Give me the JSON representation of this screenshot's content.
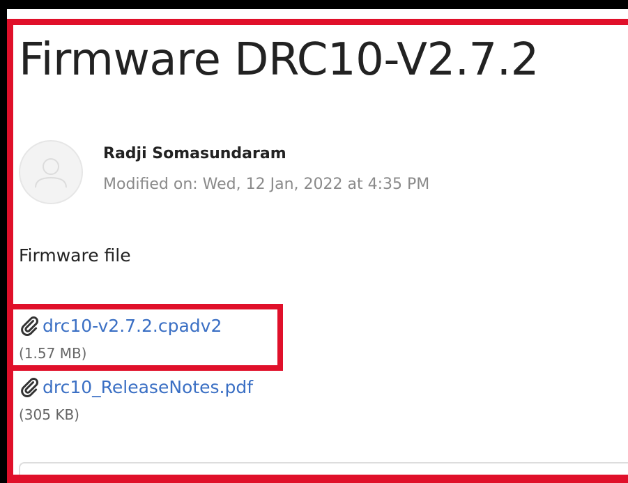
{
  "article": {
    "title": "Firmware DRC10-V2.7.2",
    "author": {
      "name": "Radji Somasundaram",
      "modified": "Modified on: Wed, 12 Jan, 2022 at 4:35 PM",
      "avatar_icon": "user-placeholder-icon"
    },
    "body_text": "Firmware file",
    "attachments": [
      {
        "filename": "drc10-v2.7.2.cpadv2",
        "size": "(1.57 MB)",
        "icon": "paperclip-icon"
      },
      {
        "filename": "drc10_ReleaseNotes.pdf",
        "size": "(305 KB)",
        "icon": "paperclip-icon"
      }
    ]
  },
  "colors": {
    "highlight": "#e0102a",
    "link": "#3a6fc4",
    "title_text": "#222222",
    "muted_text": "#8a8a8a"
  }
}
